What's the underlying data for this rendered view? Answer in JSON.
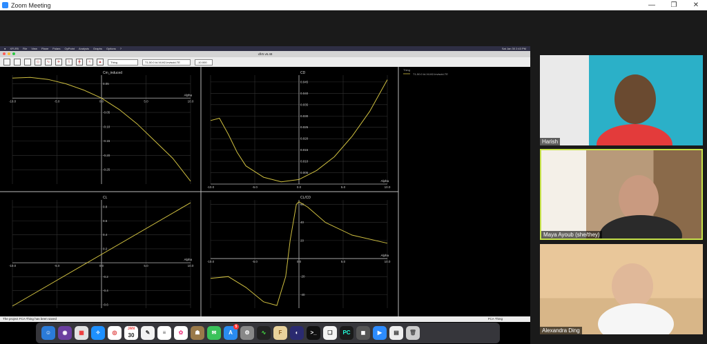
{
  "window": {
    "title": "Zoom Meeting",
    "controls": [
      "—",
      "❐",
      "✕"
    ]
  },
  "mac_menu": {
    "app": "XFLR5",
    "items": [
      "File",
      "View",
      "Plane",
      "Polars",
      "OpPoint",
      "Analysis",
      "Graphs",
      "Options",
      "?"
    ],
    "clock": "Sat Jan 30 2:43 PM"
  },
  "app": {
    "title": "xflr5 v6.48"
  },
  "toolbar": {
    "plane_select": "Thing",
    "polar_select": "T1-50.0 kt-VLM2-Inviscid-TE",
    "value_select": "-10.000"
  },
  "legend_text": {
    "name": "Thing",
    "series": "T1-50.0 kt-VLM2-Inviscid-TE"
  },
  "status": {
    "left": "The project FCA Thing has been saved",
    "right": "FCA Thing"
  },
  "dock": {
    "calendar_month": "JAN",
    "calendar_day": "30",
    "badge": "5"
  },
  "participants": [
    {
      "name": "Harish"
    },
    {
      "name": "Maya Ayoub (she/they)"
    },
    {
      "name": "Alexandra Ding"
    }
  ],
  "chart_data": [
    {
      "type": "line",
      "title": "Cm_induced",
      "xlabel": "Alpha",
      "xlim": [
        -10,
        10
      ],
      "ylim": [
        -0.3,
        0.08
      ],
      "xticks": [
        "-10.0",
        "-5.0",
        "0.0",
        "5.0",
        "10.0"
      ],
      "yticks": [
        "0.05",
        "-0.05",
        "-0.10",
        "-0.15",
        "-0.20",
        "-0.25"
      ],
      "x": [
        -10,
        -8,
        -6,
        -4,
        -2,
        0,
        2,
        4,
        6,
        8,
        10
      ],
      "y": [
        0.07,
        0.072,
        0.065,
        0.05,
        0.028,
        0.0,
        -0.04,
        -0.09,
        -0.15,
        -0.21,
        -0.29
      ]
    },
    {
      "type": "line",
      "title": "CD",
      "xlabel": "Alpha",
      "xlim": [
        -10,
        10
      ],
      "ylim": [
        0,
        0.048
      ],
      "xticks": [
        "-10.0",
        "-5.0",
        "0.0",
        "5.0",
        "10.0"
      ],
      "yticks": [
        "0.045",
        "0.040",
        "0.035",
        "0.030",
        "0.025",
        "0.020",
        "0.015",
        "0.010",
        "0.005"
      ],
      "x": [
        -10,
        -9,
        -8,
        -7,
        -6,
        -4,
        -2,
        0,
        2,
        4,
        6,
        8,
        10
      ],
      "y": [
        0.028,
        0.029,
        0.022,
        0.014,
        0.008,
        0.003,
        0.001,
        0.002,
        0.006,
        0.012,
        0.021,
        0.032,
        0.046
      ]
    },
    {
      "type": "line",
      "title": "CL",
      "xlabel": "Alpha",
      "xlim": [
        -10,
        10
      ],
      "ylim": [
        -0.65,
        0.9
      ],
      "xticks": [
        "-10.0",
        "-5.0",
        "0.0",
        "5.0",
        "10.0"
      ],
      "yticks": [
        "0.8",
        "0.6",
        "0.4",
        "0.2",
        "-0.2",
        "-0.4",
        "-0.6"
      ],
      "x": [
        -10,
        10
      ],
      "y": [
        -0.62,
        0.86
      ]
    },
    {
      "type": "line",
      "title": "CL/CD",
      "xlabel": "Alpha",
      "xlim": [
        -10,
        10
      ],
      "ylim": [
        -55,
        65
      ],
      "xticks": [
        "-10.0",
        "-5.0",
        "0.0",
        "5.0",
        "10.0"
      ],
      "yticks": [
        "60",
        "40",
        "20",
        "-20",
        "-40"
      ],
      "x": [
        -10,
        -8,
        -6,
        -4,
        -2.5,
        -1.5,
        -1,
        -0.3,
        0,
        1,
        3,
        6,
        10
      ],
      "y": [
        -22,
        -20,
        -32,
        -48,
        -52,
        -20,
        20,
        60,
        63,
        57,
        40,
        26,
        17
      ]
    }
  ]
}
